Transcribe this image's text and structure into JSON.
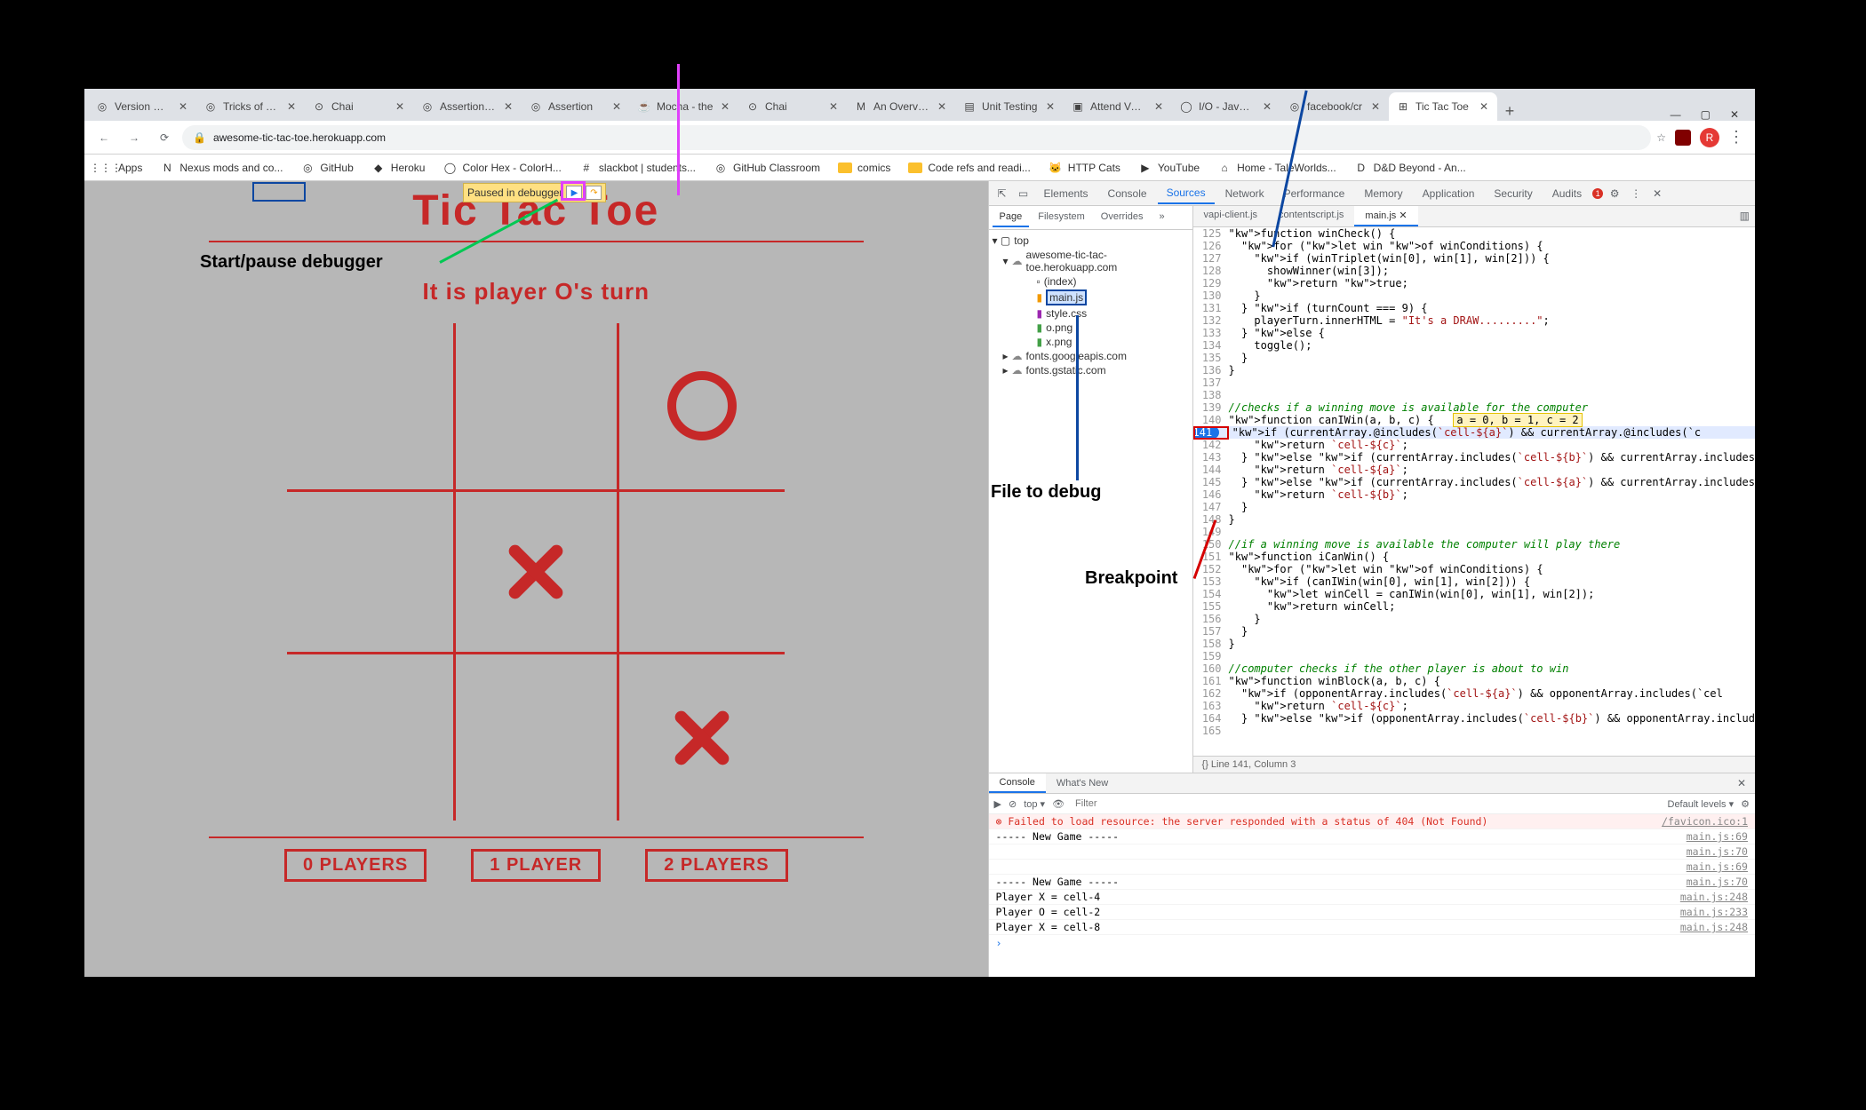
{
  "window": {
    "minimize": "—",
    "maximize": "▢",
    "close": "✕"
  },
  "tabs": [
    {
      "favicon": "◎",
      "title": "Version Cont"
    },
    {
      "favicon": "◎",
      "title": "Tricks of The"
    },
    {
      "favicon": "⊙",
      "title": "Chai"
    },
    {
      "favicon": "◎",
      "title": "Assertion Sty"
    },
    {
      "favicon": "◎",
      "title": "Assertion"
    },
    {
      "favicon": "☕",
      "title": "Mocha - the"
    },
    {
      "favicon": "⊙",
      "title": "Chai"
    },
    {
      "favicon": "M",
      "title": "An Overview"
    },
    {
      "favicon": "▤",
      "title": "Unit Testing"
    },
    {
      "favicon": "▣",
      "title": "Attend Verm"
    },
    {
      "favicon": "◯",
      "title": "I/O - JavaSc"
    },
    {
      "favicon": "◎",
      "title": "facebook/cr"
    },
    {
      "favicon": "⊞",
      "title": "Tic Tac Toe",
      "active": true
    }
  ],
  "new_tab": "+",
  "toolbar": {
    "lock": "🔒",
    "url": "awesome-tic-tac-toe.herokuapp.com",
    "star": "☆",
    "avatar": "R",
    "kebab": "⋮"
  },
  "bookmarks": [
    {
      "icon": "⋮⋮⋮",
      "label": "Apps"
    },
    {
      "icon": "N",
      "label": "Nexus mods and co..."
    },
    {
      "icon": "◎",
      "label": "GitHub"
    },
    {
      "icon": "◆",
      "label": "Heroku"
    },
    {
      "icon": "◯",
      "label": "Color Hex - ColorH..."
    },
    {
      "icon": "#",
      "label": "slackbot | students..."
    },
    {
      "icon": "◎",
      "label": "GitHub Classroom"
    },
    {
      "icon": "▭",
      "label": "comics",
      "folder": true
    },
    {
      "icon": "▭",
      "label": "Code refs and readi...",
      "folder": true
    },
    {
      "icon": "🐱",
      "label": "HTTP Cats"
    },
    {
      "icon": "▶",
      "label": "YouTube"
    },
    {
      "icon": "⌂",
      "label": "Home - TaleWorlds..."
    },
    {
      "icon": "D",
      "label": "D&D Beyond - An..."
    }
  ],
  "game": {
    "title": "Tic  Tac  Toe",
    "status": "It is player O's turn",
    "modes": [
      "0 PLAYERS",
      "1 PLAYER",
      "2 PLAYERS"
    ]
  },
  "pause": {
    "label": "Paused in debugger",
    "play": "▶",
    "step": "↷"
  },
  "annotations": {
    "start": "Start/pause debugger",
    "file": "File to debug",
    "bp": "Breakpoint"
  },
  "devtools": {
    "inspect": "⇱",
    "device": "▭",
    "tabs": [
      "Elements",
      "Console",
      "Sources",
      "Network",
      "Performance",
      "Memory",
      "Application",
      "Security",
      "Audits"
    ],
    "active_tab": "Sources",
    "errcount": "1",
    "gear": "⚙",
    "kebab": "⋮",
    "close": "✕",
    "nav_tabs": [
      "Page",
      "Filesystem",
      "Overrides",
      "»"
    ],
    "tree": {
      "top": "top",
      "domain": "awesome-tic-tac-toe.herokuapp.com",
      "index": "(index)",
      "mainjs": "main.js",
      "style": "style.css",
      "opng": "o.png",
      "xpng": "x.png",
      "fonts1": "fonts.googleapis.com",
      "fonts2": "fonts.gstatic.com"
    },
    "editor_tabs": [
      "vapi-client.js",
      "contentscript.js",
      "main.js"
    ],
    "editor_active": "main.js",
    "dock": "▥",
    "code": [
      {
        "n": 125,
        "t": "function winCheck() {",
        "c": "kw"
      },
      {
        "n": 126,
        "t": "  for (let win of winConditions) {"
      },
      {
        "n": 127,
        "t": "    if (winTriplet(win[0], win[1], win[2])) {"
      },
      {
        "n": 128,
        "t": "      showWinner(win[3]);"
      },
      {
        "n": 129,
        "t": "      return true;",
        "kwreturn": true
      },
      {
        "n": 130,
        "t": "    }"
      },
      {
        "n": 131,
        "t": "  } if (turnCount === 9) {"
      },
      {
        "n": 132,
        "t": "    playerTurn.innerHTML = \"It's a DRAW.........\";"
      },
      {
        "n": 133,
        "t": "  } else {"
      },
      {
        "n": 134,
        "t": "    toggle();"
      },
      {
        "n": 135,
        "t": "  }"
      },
      {
        "n": 136,
        "t": "}"
      },
      {
        "n": 137,
        "t": ""
      },
      {
        "n": 138,
        "t": ""
      },
      {
        "n": 139,
        "t": "//checks if a winning move is available for the computer",
        "cm": true
      },
      {
        "n": 140,
        "t": "function canIWin(a, b, c) {   a = 0, b = 1, c = 2",
        "hl": true
      },
      {
        "n": 141,
        "t": "  if (currentArray.@includes(`cell-${a}`) && currentArray.@includes(`c",
        "bp": true,
        "exec": true
      },
      {
        "n": 142,
        "t": "    return `cell-${c}`;"
      },
      {
        "n": 143,
        "t": "  } else if (currentArray.includes(`cell-${b}`) && currentArray.includes"
      },
      {
        "n": 144,
        "t": "    return `cell-${a}`;"
      },
      {
        "n": 145,
        "t": "  } else if (currentArray.includes(`cell-${a}`) && currentArray.includes"
      },
      {
        "n": 146,
        "t": "    return `cell-${b}`;"
      },
      {
        "n": 147,
        "t": "  }"
      },
      {
        "n": 148,
        "t": "}"
      },
      {
        "n": 149,
        "t": ""
      },
      {
        "n": 150,
        "t": "//if a winning move is available the computer will play there",
        "cm": true
      },
      {
        "n": 151,
        "t": "function iCanWin() {"
      },
      {
        "n": 152,
        "t": "  for (let win of winConditions) {"
      },
      {
        "n": 153,
        "t": "    if (canIWin(win[0], win[1], win[2])) {"
      },
      {
        "n": 154,
        "t": "      let winCell = canIWin(win[0], win[1], win[2]);"
      },
      {
        "n": 155,
        "t": "      return winCell;"
      },
      {
        "n": 156,
        "t": "    }"
      },
      {
        "n": 157,
        "t": "  }"
      },
      {
        "n": 158,
        "t": "}"
      },
      {
        "n": 159,
        "t": ""
      },
      {
        "n": 160,
        "t": "//computer checks if the other player is about to win",
        "cm": true
      },
      {
        "n": 161,
        "t": "function winBlock(a, b, c) {"
      },
      {
        "n": 162,
        "t": "  if (opponentArray.includes(`cell-${a}`) && opponentArray.includes(`cel"
      },
      {
        "n": 163,
        "t": "    return `cell-${c}`;"
      },
      {
        "n": 164,
        "t": "  } else if (opponentArray.includes(`cell-${b}`) && opponentArray.includ"
      },
      {
        "n": 165,
        "t": "    "
      }
    ],
    "status": "{}   Line 141, Column 3"
  },
  "console": {
    "tabs": [
      "Console",
      "What's New"
    ],
    "toolbar": {
      "play": "▶",
      "stop": "⊘",
      "ctx": "top",
      "eye": "👁",
      "filter_ph": "Filter",
      "level": "Default levels ▾",
      "gear": "⚙"
    },
    "rows": [
      {
        "type": "err",
        "msg": "⊗ Failed to load resource: the server responded with a status of 404 (Not Found)",
        "src": "/favicon.ico:1"
      },
      {
        "msg": "  ----- New Game -----",
        "src": "main.js:69"
      },
      {
        "msg": "",
        "src": "main.js:70"
      },
      {
        "msg": "",
        "src": "main.js:69"
      },
      {
        "msg": "  ----- New Game -----",
        "src": "main.js:70"
      },
      {
        "msg": "  Player X = cell-4",
        "src": "main.js:248"
      },
      {
        "msg": "  Player O = cell-2",
        "src": "main.js:233"
      },
      {
        "msg": "  Player X = cell-8",
        "src": "main.js:248"
      }
    ],
    "prompt": "›"
  }
}
